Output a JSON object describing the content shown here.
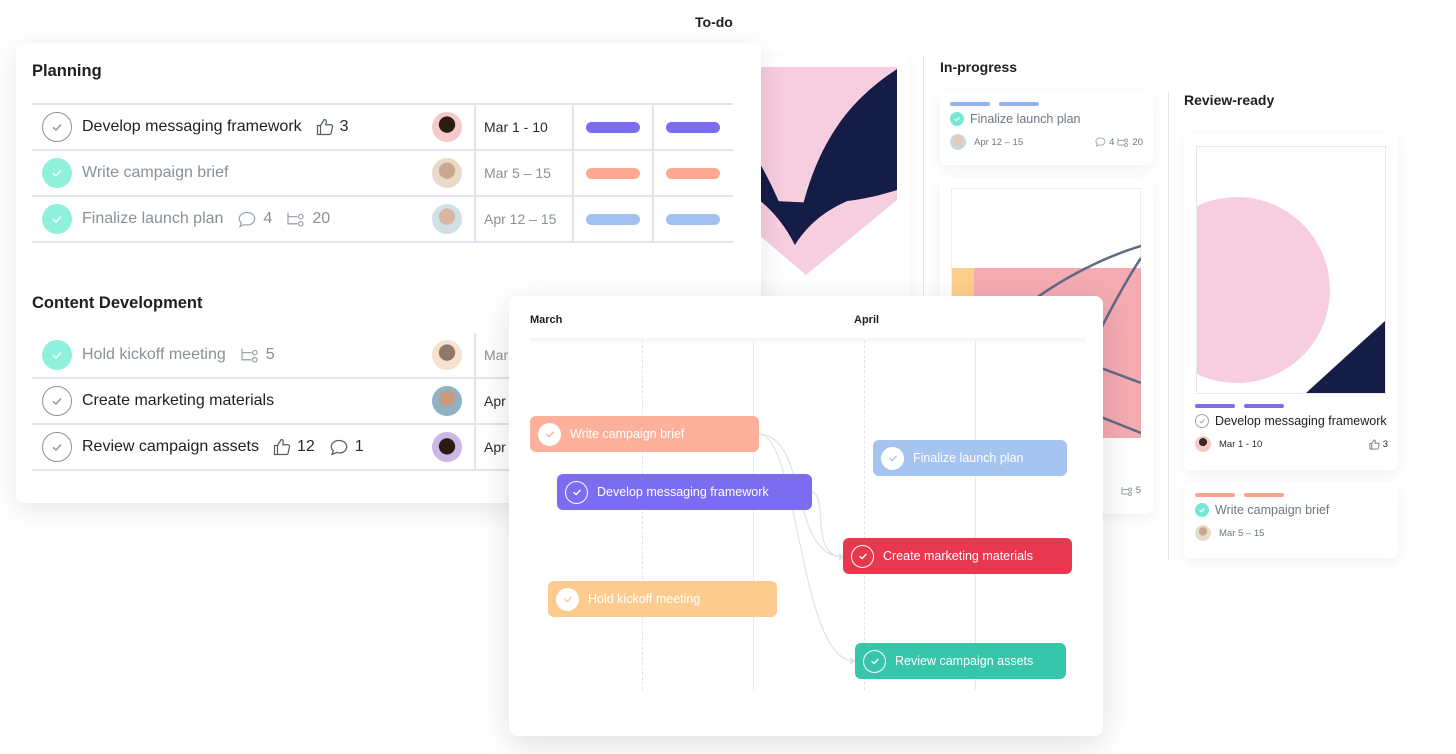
{
  "board": {
    "columns": [
      {
        "title": "To-do"
      },
      {
        "title": "In-progress"
      },
      {
        "title": "Review-ready"
      }
    ],
    "in_progress_cards": [
      {
        "tag_color": "#8fb4ee",
        "title": "Finalize launch plan",
        "done": true,
        "date": "Apr 12 – 15",
        "comments": "4",
        "subtasks": "20"
      },
      {
        "subtasks": "5"
      }
    ],
    "review_ready_cards": [
      {
        "tag_color": "#7b6cf0",
        "title": "Develop messaging framework",
        "done": false,
        "date": "Mar 1 - 10",
        "likes": "3"
      },
      {
        "tag_color": "#fda48f",
        "title": "Write campaign brief",
        "done": true,
        "date": "Mar 5 – 15"
      }
    ]
  },
  "list": {
    "sections": [
      {
        "title": "Planning",
        "tasks": [
          {
            "name": "Develop messaging framework",
            "done": false,
            "likes": "3",
            "date": "Mar 1 - 10",
            "color": "#7b6cf0",
            "avatar": "#f6c9c9"
          },
          {
            "name": "Write campaign brief",
            "done": true,
            "date": "Mar 5 – 15",
            "color": "#fdaa92",
            "avatar": "#e8dcc8"
          },
          {
            "name": "Finalize launch plan",
            "done": true,
            "comments": "4",
            "subtasks": "20",
            "date": "Apr 12 – 15",
            "color": "#a2c0f0",
            "avatar": "#cfe0e6"
          }
        ]
      },
      {
        "title": "Content Development",
        "tasks": [
          {
            "name": "Hold kickoff meeting",
            "done": true,
            "subtasks": "5",
            "date": "Mar",
            "avatar": "#f7e1cf"
          },
          {
            "name": "Create marketing materials",
            "done": false,
            "date": "Apr",
            "avatar": "#8fb3c4"
          },
          {
            "name": "Review campaign assets",
            "done": false,
            "likes": "12",
            "comments": "1",
            "date": "Apr",
            "avatar": "#cdb5e6"
          }
        ]
      }
    ]
  },
  "timeline": {
    "months": [
      "March",
      "April"
    ],
    "bars": [
      {
        "label": "Write campaign brief",
        "color": "#fdb09a",
        "check_style": "filled",
        "check_color": "#fdb09a"
      },
      {
        "label": "Develop messaging framework",
        "color": "#7b6cf0",
        "check_style": "ring"
      },
      {
        "label": "Finalize launch plan",
        "color": "#a5c4f0",
        "check_style": "filled",
        "check_color": "#a5c4f0"
      },
      {
        "label": "Create marketing materials",
        "color": "#e8384f",
        "check_style": "ring"
      },
      {
        "label": "Hold kickoff meeting",
        "color": "#fdcb8e",
        "check_style": "filled",
        "check_color": "#fdcb8e"
      },
      {
        "label": "Review campaign assets",
        "color": "#37c5ab",
        "check_style": "ring"
      }
    ]
  }
}
